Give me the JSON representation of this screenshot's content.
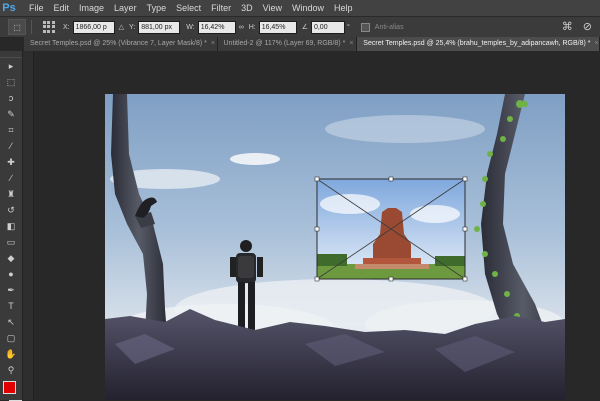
{
  "app": {
    "logo": "Ps"
  },
  "menu": [
    "File",
    "Edit",
    "Image",
    "Layer",
    "Type",
    "Select",
    "Filter",
    "3D",
    "View",
    "Window",
    "Help"
  ],
  "options": {
    "x_label": "X:",
    "x_value": "1866,00 p",
    "y_label": "Y:",
    "y_value": "881,00 px",
    "w_label": "W:",
    "w_value": "16,42%",
    "h_label": "H:",
    "h_value": "16,45%",
    "angle_value": "0,00",
    "angle_unit": "°",
    "antialias_label": "Anti-alias"
  },
  "tabs": [
    {
      "label": "Secret Temples.psd @ 25% (Vibrance 7, Layer Mask/8) *",
      "active": false
    },
    {
      "label": "Untitled-2 @ 117% (Layer 69, RGB/8) *",
      "active": false
    },
    {
      "label": "Secret Temples.psd @ 25,4% (brahu_temples_by_adipancawh, RGB/8) *",
      "active": true
    }
  ],
  "colors": {
    "foreground": "#e00000",
    "background": "#ffffff"
  }
}
